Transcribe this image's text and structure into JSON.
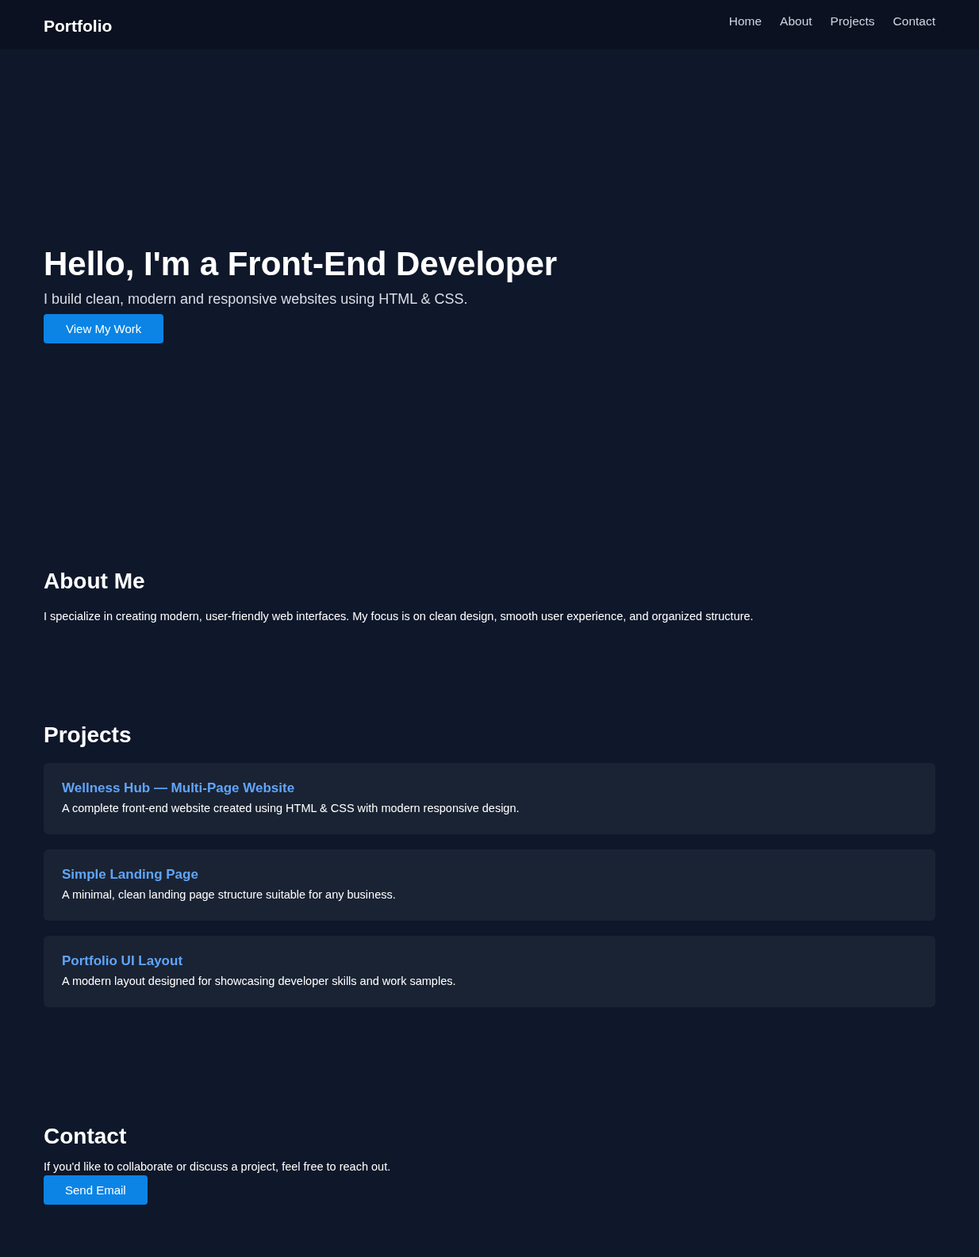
{
  "header": {
    "logo": "Portfolio",
    "nav": [
      {
        "label": "Home"
      },
      {
        "label": "About"
      },
      {
        "label": "Projects"
      },
      {
        "label": "Contact"
      }
    ]
  },
  "hero": {
    "title": "Hello, I'm a Front-End Developer",
    "subtitle": "I build clean, modern and responsive websites using HTML & CSS.",
    "button": "View My Work"
  },
  "about": {
    "title": "About Me",
    "text": "I specialize in creating modern, user-friendly web interfaces. My focus is on clean design, smooth user experience, and organized structure."
  },
  "projects": {
    "title": "Projects",
    "items": [
      {
        "title": "Wellness Hub — Multi-Page Website",
        "description": "A complete front-end website created using HTML & CSS with modern responsive design."
      },
      {
        "title": "Simple Landing Page",
        "description": "A minimal, clean landing page structure suitable for any business."
      },
      {
        "title": "Portfolio UI Layout",
        "description": "A modern layout designed for showcasing developer skills and work samples."
      }
    ]
  },
  "contact": {
    "title": "Contact",
    "text": "If you'd like to collaborate or discuss a project, feel free to reach out.",
    "button": "Send Email"
  }
}
